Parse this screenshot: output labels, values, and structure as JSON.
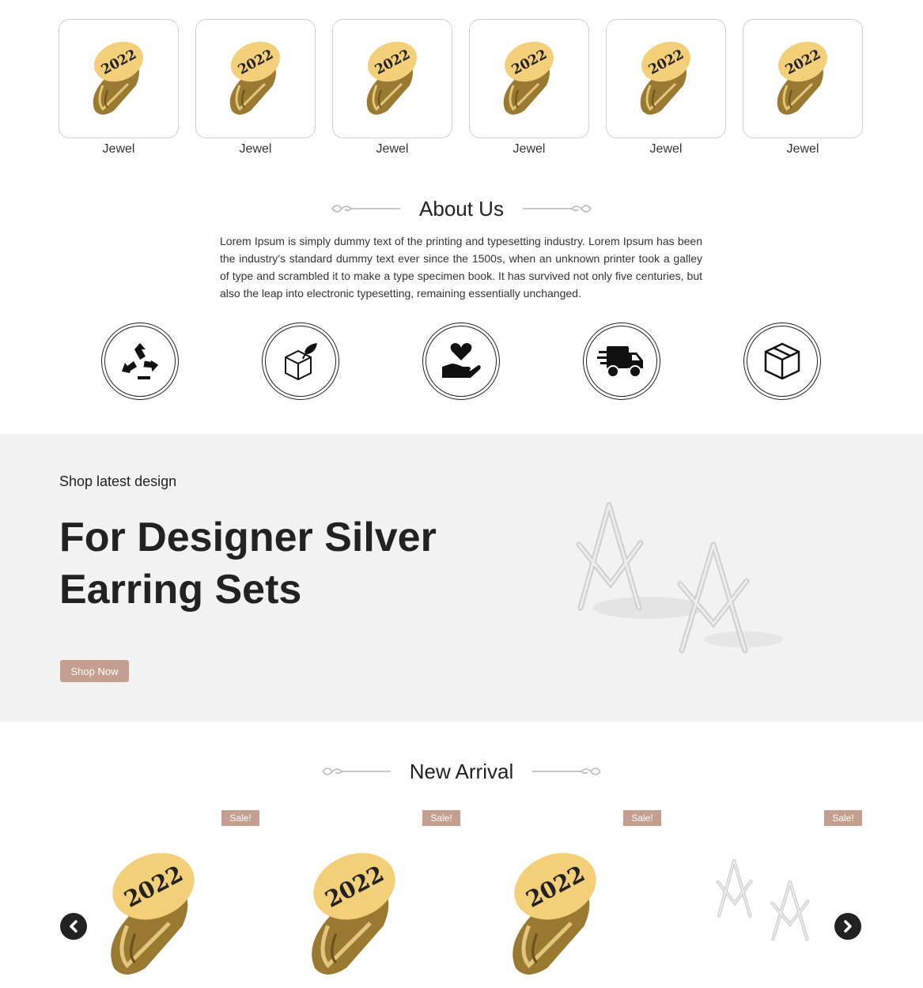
{
  "categories": [
    {
      "label": "Jewel",
      "ring_text": "2022"
    },
    {
      "label": "Jewel",
      "ring_text": "2022"
    },
    {
      "label": "Jewel",
      "ring_text": "2022"
    },
    {
      "label": "Jewel",
      "ring_text": "2022"
    },
    {
      "label": "Jewel",
      "ring_text": "2022"
    },
    {
      "label": "Jewel",
      "ring_text": "2022"
    }
  ],
  "about": {
    "title": "About Us",
    "text": "Lorem Ipsum is simply dummy text of the printing and typesetting industry. Lorem Ipsum has been the industry's standard dummy text ever since the 1500s, when an unknown printer took a galley of type and scrambled it to make a type specimen book. It has survived not only five centuries, but also the leap into electronic typesetting, remaining essentially unchanged."
  },
  "features": [
    {
      "icon": "recycle-icon"
    },
    {
      "icon": "eco-box-icon"
    },
    {
      "icon": "heart-hand-icon"
    },
    {
      "icon": "delivery-truck-icon"
    },
    {
      "icon": "package-box-icon"
    }
  ],
  "banner": {
    "subtitle": "Shop latest design",
    "title": "For Designer Silver Earring Sets",
    "button_label": "Shop Now"
  },
  "new_arrival": {
    "title": "New Arrival",
    "products": [
      {
        "badge": "Sale!",
        "kind": "ring",
        "ring_text": "2022"
      },
      {
        "badge": "Sale!",
        "kind": "ring",
        "ring_text": "2022"
      },
      {
        "badge": "Sale!",
        "kind": "ring",
        "ring_text": "2022"
      },
      {
        "badge": "Sale!",
        "kind": "earrings"
      }
    ]
  },
  "colors": {
    "accent": "#c49f8f",
    "gold": "#b08a3a",
    "gold_face": "#f4cf7a",
    "banner_bg": "#f2f2f2"
  }
}
